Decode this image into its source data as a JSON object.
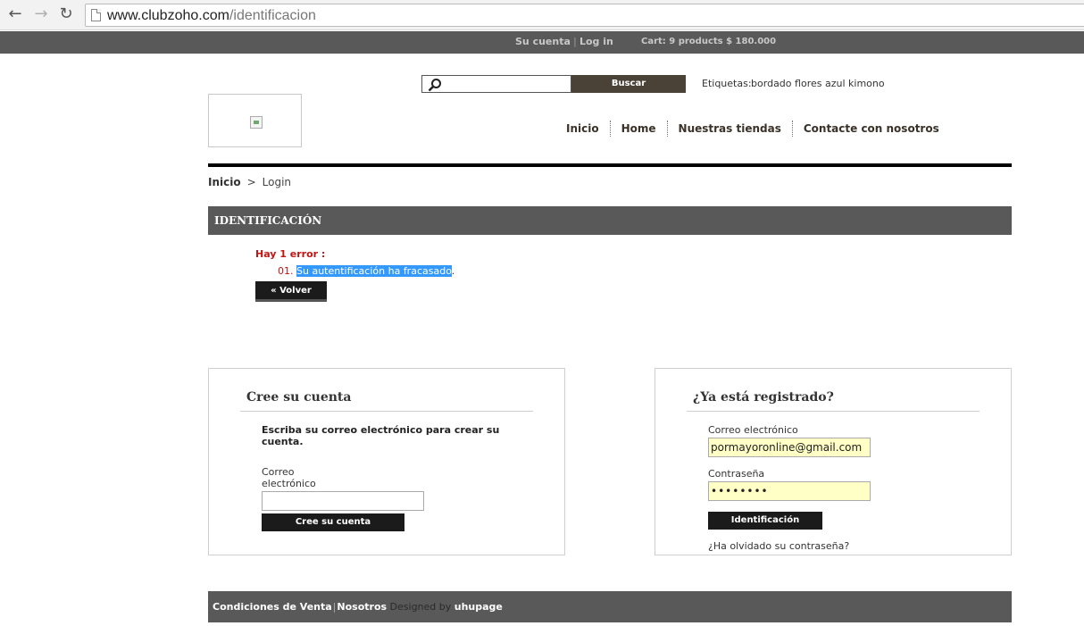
{
  "browser": {
    "url_host": "www.clubzoho.com",
    "url_path": "/identificacion",
    "back_icon": "arrow-left-icon",
    "forward_icon": "arrow-right-icon",
    "reload_icon": "reload-icon"
  },
  "topbar": {
    "account": "Su cuenta",
    "login": "Log in",
    "cart": "Cart: 9 products $ 180.000"
  },
  "search": {
    "button": "Buscar",
    "tags_label": "Etiquetas:",
    "tags": [
      "bordado",
      "flores",
      "azul",
      "kimono"
    ]
  },
  "nav": {
    "items": [
      "Inicio",
      "Home",
      "Nuestras tiendas",
      "Contacte con nosotros"
    ]
  },
  "breadcrumb": {
    "home": "Inicio",
    "separator": ">",
    "current": "Login"
  },
  "page": {
    "title": "IDENTIFICACIÓN"
  },
  "error": {
    "heading": "Hay 1 error :",
    "number": "01.",
    "message": "Su autentificación ha fracasado",
    "trailing": ".",
    "back": "« Volver"
  },
  "create_account": {
    "title": "Cree su cuenta",
    "lead": "Escriba su correo electrónico para crear su cuenta.",
    "email_label_1": "Correo",
    "email_label_2": "electrónico",
    "button": "Cree su cuenta"
  },
  "login_box": {
    "title": "¿Ya está registrado?",
    "email_label": "Correo electrónico",
    "email_value": "pormayoronline@gmail.com",
    "password_label": "Contraseña",
    "password_value": "••••••••",
    "button": "Identificación",
    "forgot": "¿Ha olvidado su contraseña?"
  },
  "footer": {
    "terms": "Condiciones de Venta",
    "about": "Nosotros",
    "designed_by": "Designed by",
    "designer": "uhupage"
  },
  "colors": {
    "dark_bar": "#595959",
    "error_red": "#c31414",
    "input_highlight": "#ffffc6",
    "selection": "#3399ff"
  }
}
